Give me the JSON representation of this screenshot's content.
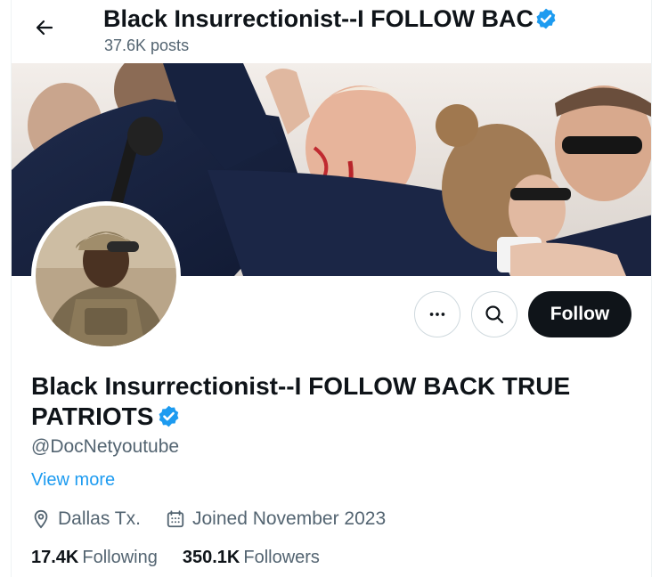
{
  "header": {
    "back_icon": "arrow-left-icon",
    "title": "Black Insurrectionist--I FOLLOW BACK TRUE PATRIOTS",
    "post_count": "37.6K posts"
  },
  "profile": {
    "display_name": "Black Insurrectionist--I FOLLOW BACK TRUE PATRIOTS",
    "verified_icon": "verified-badge-icon",
    "verified_color": "#1d9bf0",
    "handle": "@DocNetyoutube",
    "view_more": "View more",
    "location": "Dallas Tx.",
    "location_icon": "location-pin-icon",
    "joined": "Joined November 2023",
    "joined_icon": "calendar-icon"
  },
  "actions": {
    "more_icon": "more-dots-icon",
    "search_icon": "search-icon",
    "follow_label": "Follow"
  },
  "stats": {
    "following_count": "17.4K",
    "following_label": "Following",
    "followers_count": "350.1K",
    "followers_label": "Followers"
  },
  "colors": {
    "accent": "#1d9bf0",
    "text_primary": "#0f1419",
    "text_secondary": "#536471",
    "follow_button_bg": "#0f1419"
  }
}
